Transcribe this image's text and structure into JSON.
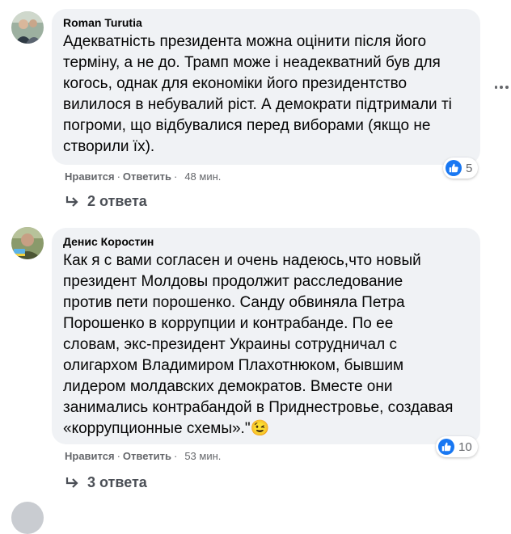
{
  "comments": [
    {
      "author": "Roman Turutia",
      "text": "Адекватність президента можна оцінити після його\nтерміну, а не до. Трамп може і неадекватний був для\nкогось, однак для економіки його президентство\nвилилося в небувалий ріст. А демократи підтримали ті\nпогроми, що відбувалися перед виборами (якщо не\nстворили їх).",
      "like_label": "Нравится",
      "reply_label": "Ответить",
      "time": "48 мин.",
      "reaction_count": "5",
      "replies_label": "2 ответа"
    },
    {
      "author": "Денис Коростин",
      "text": "Как я с вами согласен и очень надеюсь,что новый\nпрезидент Молдовы продолжит расследование\nпротив пети порошенко. Санду обвиняла Петра\nПорошенко в коррупции и контрабанде. По ее\nсловам, экс-президент Украины сотрудничал с\nолигархом Владимиром Плахотнюком, бывшим\nлидером молдавских демократов. Вместе они\nзанимались контрабандой в Приднестровье, создавая\n«коррупционные схемы».\"",
      "emoji": "😉",
      "like_label": "Нравится",
      "reply_label": "Ответить",
      "time": "53 мин.",
      "reaction_count": "10",
      "replies_label": "3 ответа"
    }
  ],
  "colors": {
    "bubble": "#f0f2f5",
    "like_blue": "#1877f2",
    "meta_gray": "#65676b"
  },
  "icons": {
    "like": "thumbs-up-icon",
    "reply_arrow": "reply-arrow-icon",
    "more": "more-options-icon"
  }
}
